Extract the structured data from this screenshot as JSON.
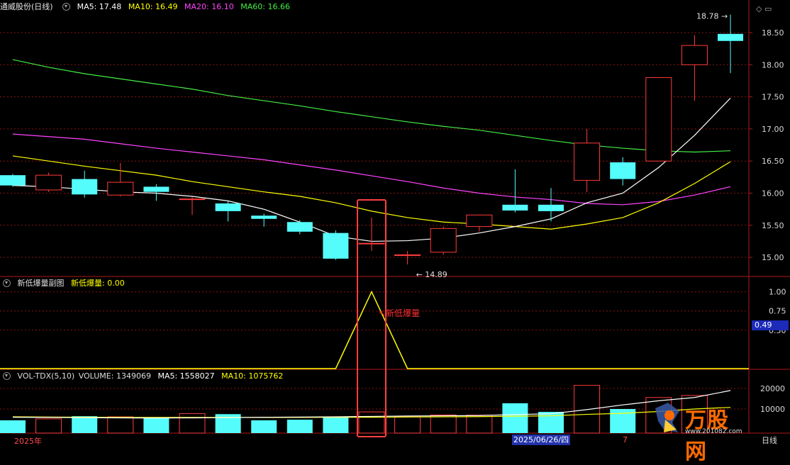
{
  "stock_name": "通威股份(日线)",
  "ma_legend": [
    {
      "label": "MA5: 17.48",
      "color": "#ffffff"
    },
    {
      "label": "MA10: 16.49",
      "color": "#ffff00"
    },
    {
      "label": "MA20: 16.10",
      "color": "#ff44ff"
    },
    {
      "label": "MA60: 16.66",
      "color": "#44ee44"
    }
  ],
  "indicator": {
    "title": "新低爆量副图",
    "value_label": "新低爆量: 0.00",
    "annotation": "新低爆量",
    "current_tag": "0.49"
  },
  "volume_header": {
    "title": "VOL-TDX(5,10)",
    "volume": "VOLUME: 1349069",
    "ma5": "MA5: 1558027",
    "ma10": "MA10: 1075762"
  },
  "price_high_label": "18.78",
  "price_low_label": "14.89",
  "bottom_bar": {
    "year": "2025年",
    "date": "2025/06/26/四",
    "tail": "7",
    "right": "日线"
  },
  "brand": {
    "name": "万股网",
    "url": "www.201082.com"
  },
  "colors": {
    "up": "#ff3b3b",
    "down": "#54fcfc",
    "ma5": "#ffffff",
    "ma10": "#ffff00",
    "ma20": "#ff44ff",
    "ma60": "#44ee44",
    "grid": "#8a1010",
    "indicator": "#ffff00"
  },
  "chart_data": {
    "type": "candlestick",
    "price_axis": {
      "ticks": [
        15.0,
        15.5,
        16.0,
        16.5,
        17.0,
        17.5,
        18.0,
        18.5
      ]
    },
    "candles": [
      {
        "o": 16.28,
        "c": 16.12,
        "h": 16.3,
        "l": 16.1
      },
      {
        "o": 16.05,
        "c": 16.28,
        "h": 16.32,
        "l": 16.02
      },
      {
        "o": 16.22,
        "c": 15.98,
        "h": 16.35,
        "l": 15.93
      },
      {
        "o": 15.97,
        "c": 16.17,
        "h": 16.47,
        "l": 15.95
      },
      {
        "o": 16.1,
        "c": 16.02,
        "h": 16.14,
        "l": 15.88
      },
      {
        "o": 15.91,
        "c": 15.91,
        "h": 15.94,
        "l": 15.66
      },
      {
        "o": 15.84,
        "c": 15.72,
        "h": 15.88,
        "l": 15.56
      },
      {
        "o": 15.65,
        "c": 15.6,
        "h": 15.68,
        "l": 15.48
      },
      {
        "o": 15.55,
        "c": 15.4,
        "h": 15.58,
        "l": 15.36
      },
      {
        "o": 15.38,
        "c": 14.98,
        "h": 15.42,
        "l": 14.96
      },
      {
        "o": 15.21,
        "c": 15.22,
        "h": 15.62,
        "l": 15.1
      },
      {
        "o": 15.04,
        "c": 15.04,
        "h": 15.1,
        "l": 14.89
      },
      {
        "o": 15.08,
        "c": 15.45,
        "h": 15.48,
        "l": 15.04
      },
      {
        "o": 15.48,
        "c": 15.66,
        "h": 15.66,
        "l": 15.4
      },
      {
        "o": 15.82,
        "c": 15.73,
        "h": 16.37,
        "l": 15.7
      },
      {
        "o": 15.82,
        "c": 15.72,
        "h": 16.08,
        "l": 15.56
      },
      {
        "o": 16.2,
        "c": 16.78,
        "h": 17.0,
        "l": 16.02
      },
      {
        "o": 16.48,
        "c": 16.22,
        "h": 16.56,
        "l": 16.12
      },
      {
        "o": 16.5,
        "c": 17.8,
        "h": 17.8,
        "l": 16.5
      },
      {
        "o": 18.0,
        "c": 18.3,
        "h": 18.46,
        "l": 17.44
      },
      {
        "o": 18.48,
        "c": 18.37,
        "h": 18.78,
        "l": 17.87
      }
    ],
    "ma5": [
      16.12,
      16.1,
      16.06,
      16.02,
      16.0,
      15.95,
      15.88,
      15.75,
      15.55,
      15.33,
      15.25,
      15.26,
      15.3,
      15.38,
      15.48,
      15.6,
      15.85,
      16.0,
      16.4,
      16.9,
      17.48
    ],
    "ma10": [
      16.58,
      16.5,
      16.42,
      16.35,
      16.28,
      16.18,
      16.1,
      16.02,
      15.95,
      15.85,
      15.72,
      15.62,
      15.55,
      15.52,
      15.48,
      15.44,
      15.52,
      15.62,
      15.85,
      16.15,
      16.49
    ],
    "ma20": [
      16.92,
      16.88,
      16.84,
      16.77,
      16.7,
      16.64,
      16.58,
      16.52,
      16.44,
      16.36,
      16.27,
      16.18,
      16.08,
      16.0,
      15.94,
      15.9,
      15.84,
      15.82,
      15.87,
      15.97,
      16.1
    ],
    "ma60": [
      18.08,
      17.96,
      17.86,
      17.78,
      17.7,
      17.62,
      17.52,
      17.44,
      17.36,
      17.27,
      17.19,
      17.11,
      17.04,
      16.98,
      16.9,
      16.82,
      16.75,
      16.7,
      16.66,
      16.64,
      16.66
    ],
    "indicator_series": [
      0,
      0,
      0,
      0,
      0,
      0,
      0,
      0,
      0,
      0,
      1,
      0,
      0,
      0,
      0,
      0,
      0,
      0,
      0,
      0,
      0
    ],
    "indicator_axis": {
      "ticks": [
        0.5,
        0.75,
        1.0
      ]
    },
    "volume_axis": {
      "ticks": [
        10000,
        20000
      ]
    },
    "volume_bars": [
      4500,
      5200,
      6500,
      6200,
      5900,
      7800,
      7500,
      4500,
      4800,
      6200,
      8600,
      6200,
      7100,
      7000,
      12800,
      8600,
      21500,
      10000,
      15600,
      16600
    ],
    "volume_ma5": [
      6000,
      5900,
      5800,
      5700,
      5600,
      5700,
      5800,
      6000,
      6100,
      6200,
      6400,
      6600,
      6700,
      6800,
      7300,
      7700,
      9700,
      12000,
      14000,
      15600,
      19000
    ],
    "volume_ma10": [
      6200,
      6100,
      6000,
      5900,
      5900,
      5900,
      5900,
      5900,
      5900,
      6000,
      6000,
      6100,
      6200,
      6300,
      6500,
      6700,
      7400,
      7900,
      8800,
      10000,
      10800
    ],
    "highlight_index": 10
  }
}
